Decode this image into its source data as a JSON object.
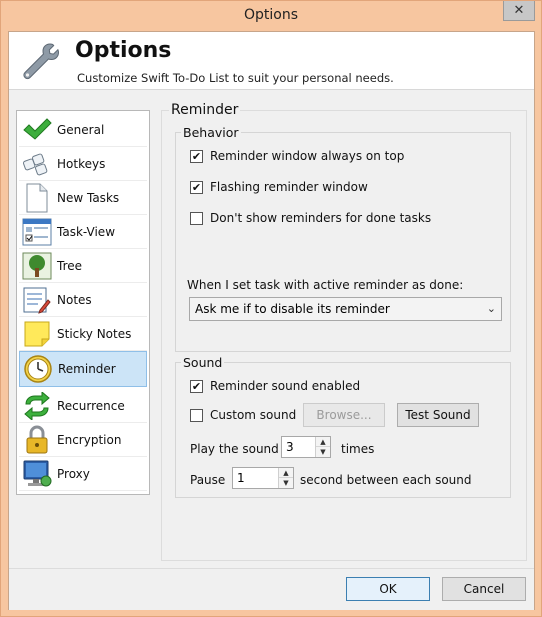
{
  "window": {
    "title": "Options",
    "close_glyph": "✕"
  },
  "header": {
    "title": "Options",
    "subtitle": "Customize Swift To-Do List to suit your personal needs.",
    "icon": "wrench-icon"
  },
  "sidebar": {
    "items": [
      {
        "label": "General",
        "icon": "checkmark-icon",
        "selected": false
      },
      {
        "label": "Hotkeys",
        "icon": "keyboard-icon",
        "selected": false
      },
      {
        "label": "New Tasks",
        "icon": "document-icon",
        "selected": false
      },
      {
        "label": "Task-View",
        "icon": "task-view-icon",
        "selected": false
      },
      {
        "label": "Tree",
        "icon": "tree-icon",
        "selected": false
      },
      {
        "label": "Notes",
        "icon": "notes-icon",
        "selected": false
      },
      {
        "label": "Sticky Notes",
        "icon": "sticky-note-icon",
        "selected": false
      },
      {
        "label": "Reminder",
        "icon": "clock-icon",
        "selected": true
      },
      {
        "label": "Recurrence",
        "icon": "recurrence-icon",
        "selected": false
      },
      {
        "label": "Encryption",
        "icon": "lock-icon",
        "selected": false
      },
      {
        "label": "Proxy",
        "icon": "computer-icon",
        "selected": false
      }
    ]
  },
  "reminder": {
    "section_title": "Reminder",
    "behavior": {
      "title": "Behavior",
      "always_on_top": {
        "label": "Reminder window always on top",
        "checked": true
      },
      "flashing": {
        "label": "Flashing reminder window",
        "checked": true
      },
      "dont_show_done": {
        "label": "Don't show reminders for done tasks",
        "checked": false
      },
      "done_prompt_label": "When I set task with active reminder as done:",
      "done_action": {
        "value": "Ask me if to disable its reminder"
      }
    },
    "sound": {
      "title": "Sound",
      "sound_enabled": {
        "label": "Reminder sound enabled",
        "checked": true
      },
      "custom_sound": {
        "label": "Custom sound",
        "checked": false
      },
      "browse_label": "Browse...",
      "test_sound_label": "Test Sound",
      "play_label": "Play the sound",
      "play_times": "3",
      "times_label": "times",
      "pause_label": "Pause",
      "pause_seconds": "1",
      "pause_suffix": "second between each sound"
    }
  },
  "footer": {
    "ok_label": "OK",
    "cancel_label": "Cancel"
  }
}
